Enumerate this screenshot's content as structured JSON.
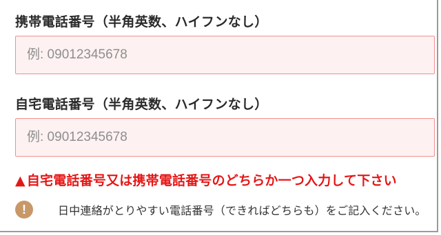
{
  "mobile": {
    "label": "携帯電話番号（半角英数、ハイフンなし）",
    "value": "",
    "placeholder": "例: 09012345678"
  },
  "home": {
    "label": "自宅電話番号（半角英数、ハイフンなし）",
    "value": "",
    "placeholder": "例: 09012345678"
  },
  "error": {
    "icon": "▲",
    "message": "自宅電話番号又は携帯電話番号のどちらか一つ入力して下さい"
  },
  "notice": {
    "icon": "exclamation-circle-icon",
    "icon_glyph": "!",
    "text": "日中連絡がとりやすい電話番号（できればどちらも）をご記入ください。"
  },
  "colors": {
    "error": "#e51616",
    "field_border": "#f08f8f",
    "field_background": "#fdf1f1",
    "notice_icon": "#c89868"
  }
}
